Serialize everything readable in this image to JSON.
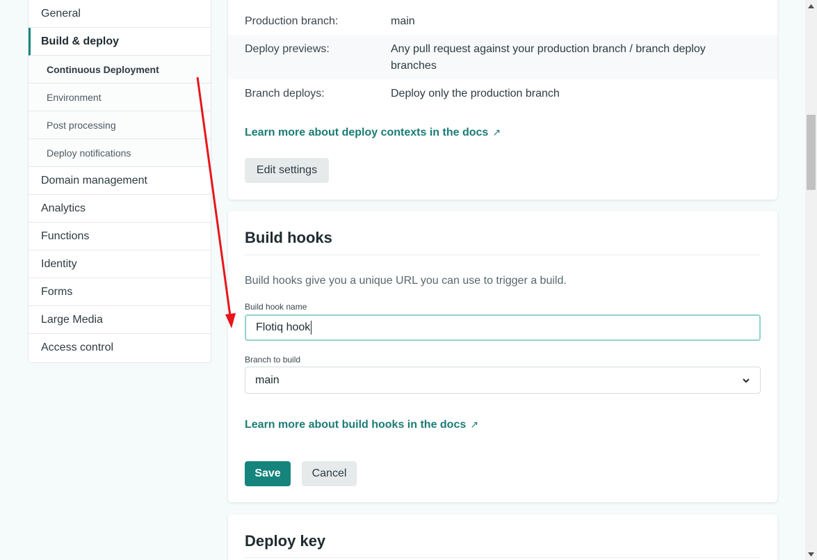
{
  "sidebar": {
    "items": [
      {
        "label": "General"
      },
      {
        "label": "Build & deploy"
      },
      {
        "label": "Continuous Deployment"
      },
      {
        "label": "Environment"
      },
      {
        "label": "Post processing"
      },
      {
        "label": "Deploy notifications"
      },
      {
        "label": "Domain management"
      },
      {
        "label": "Analytics"
      },
      {
        "label": "Functions"
      },
      {
        "label": "Identity"
      },
      {
        "label": "Forms"
      },
      {
        "label": "Large Media"
      },
      {
        "label": "Access control"
      }
    ]
  },
  "branches": {
    "production_label": "Production branch:",
    "production_value": "main",
    "previews_label": "Deploy previews:",
    "previews_value": "Any pull request against your production branch / branch deploy branches",
    "branch_deploys_label": "Branch deploys:",
    "branch_deploys_value": "Deploy only the production branch",
    "docs_link": "Learn more about deploy contexts in the docs",
    "edit_button": "Edit settings"
  },
  "build_hooks": {
    "title": "Build hooks",
    "description": "Build hooks give you a unique URL you can use to trigger a build.",
    "name_label": "Build hook name",
    "name_value": "Flotiq hook",
    "branch_label": "Branch to build",
    "branch_value": "main",
    "docs_link": "Learn more about build hooks in the docs",
    "save_button": "Save",
    "cancel_button": "Cancel"
  },
  "deploy_key": {
    "title": "Deploy key"
  },
  "icons": {
    "external_link": "external-link-icon",
    "chevron": "chevron-down-icon"
  },
  "colors": {
    "accent": "#15847d",
    "link": "#1a7c75",
    "annotation": "#e8151b"
  }
}
